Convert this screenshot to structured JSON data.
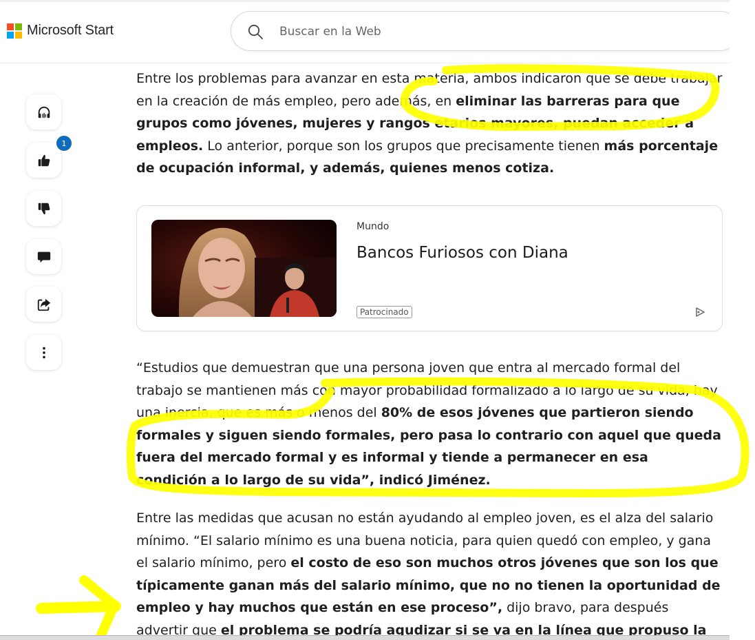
{
  "header": {
    "brand": "Microsoft Start",
    "search": {
      "placeholder": "Buscar en la Web",
      "icon": "search-icon"
    }
  },
  "sidebar": {
    "actions": [
      {
        "name": "listen",
        "icon": "headphones-icon"
      },
      {
        "name": "like",
        "icon": "thumbs-up-icon",
        "badge": "1"
      },
      {
        "name": "dislike",
        "icon": "thumbs-down-icon"
      },
      {
        "name": "comment",
        "icon": "comment-icon"
      },
      {
        "name": "share",
        "icon": "share-icon"
      },
      {
        "name": "more",
        "icon": "more-vertical-icon"
      }
    ]
  },
  "article": {
    "p1": {
      "t1": "Entre los problemas para avanzar en esta materia, ambos indicaron que se debe trabajar en la creación de más empleo, pero además, en ",
      "b1": "eliminar las barreras para que grupos como jóvenes, mujeres y rangos etarios mayores, puedan acceder a empleos.",
      "t2": " Lo anterior, porque son los grupos que precisamente tienen ",
      "b2": "más porcentaje de ocupación informal, y además, quienes menos cotiza."
    },
    "p2": {
      "t1": "“Estudios que demuestran que una persona joven que entra al mercado formal del trabajo se mantienen más con mayor probabilidad formalizado a lo largo de su vida, hay una inercia, que es más o menos del ",
      "b1": "80% de esos jóvenes que partieron siendo formales y siguen siendo formales, pero pasa lo contrario con aquel que queda fuera del mercado formal y es informal y tiende a permanecer en esa condición a lo largo de su vida”, indicó Jiménez."
    },
    "p3": {
      "t1": "Entre las medidas que acusan no están ayudando al empleo joven, es el alza del salario mínimo. “El salario mínimo es una buena noticia, para quien quedó con empleo, y gana el salario mínimo, pero ",
      "b1": "el costo de eso son muchos otros jóvenes que son los que típicamente ganan más del salario mínimo, que no no tienen la oportunidad de empleo y hay muchos que están en ese proceso”,",
      "t2": " dijo bravo, para después advertir que ",
      "b2": "el problema se podría agudizar si se va en la línea que propuso la Central Unitaria de"
    }
  },
  "sponsored_card": {
    "category": "Mundo",
    "title": "Bancos Furiosos con Diana",
    "tag": "Patrocinado",
    "icon": "ad-choices-icon"
  },
  "colors": {
    "highlight": "#ffff00",
    "badge": "#0f6cbd",
    "ms_red": "#f25022",
    "ms_green": "#7fba00",
    "ms_blue": "#00a4ef",
    "ms_yellow": "#ffb900"
  }
}
